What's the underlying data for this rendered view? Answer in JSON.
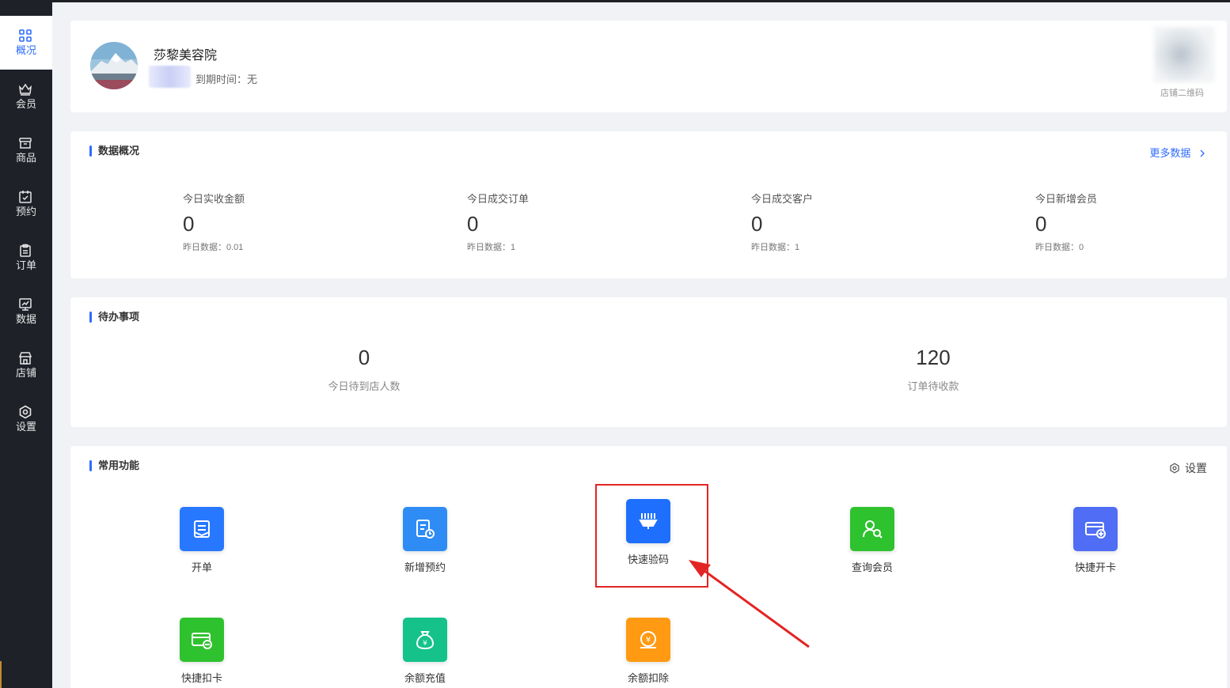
{
  "sidebar": {
    "items": [
      {
        "label": "概况",
        "icon": "grid-icon",
        "active": true
      },
      {
        "label": "会员",
        "icon": "crown-icon"
      },
      {
        "label": "商品",
        "icon": "store-box-icon"
      },
      {
        "label": "预约",
        "icon": "calendar-check-icon"
      },
      {
        "label": "订单",
        "icon": "clipboard-icon"
      },
      {
        "label": "数据",
        "icon": "monitor-chart-icon"
      },
      {
        "label": "店铺",
        "icon": "shop-icon"
      },
      {
        "label": "设置",
        "icon": "gear-icon"
      }
    ]
  },
  "shop": {
    "name": "莎黎美容院",
    "expire": "到期时间：无",
    "qr_label": "店铺二维码"
  },
  "overview": {
    "title": "数据概况",
    "more": "更多数据",
    "stats": [
      {
        "title": "今日实收金额",
        "value": "0",
        "yesterday": "昨日数据：0.01"
      },
      {
        "title": "今日成交订单",
        "value": "0",
        "yesterday": "昨日数据：1"
      },
      {
        "title": "今日成交客户",
        "value": "0",
        "yesterday": "昨日数据：1"
      },
      {
        "title": "今日新增会员",
        "value": "0",
        "yesterday": "昨日数据：0"
      }
    ]
  },
  "todo": {
    "title": "待办事项",
    "items": [
      {
        "value": "0",
        "label": "今日待到店人数"
      },
      {
        "value": "120",
        "label": "订单待收款"
      }
    ]
  },
  "functions": {
    "title": "常用功能",
    "settings": "设置",
    "items": [
      {
        "label": "开单",
        "icon": "open-order-icon",
        "color": "#2878ff"
      },
      {
        "label": "新增预约",
        "icon": "new-appointment-icon",
        "color": "#2f8cf5"
      },
      {
        "label": "快速验码",
        "icon": "scan-code-icon",
        "color": "#1f6fff"
      },
      {
        "label": "查询会员",
        "icon": "search-member-icon",
        "color": "#2fc22f"
      },
      {
        "label": "快捷开卡",
        "icon": "open-card-icon",
        "color": "#4f6df5"
      },
      {
        "label": "快捷扣卡",
        "icon": "deduct-card-icon",
        "color": "#2fc22f"
      },
      {
        "label": "余额充值",
        "icon": "money-bag-icon",
        "color": "#14c28a"
      },
      {
        "label": "余额扣除",
        "icon": "coin-deduct-icon",
        "color": "#ff9a12"
      }
    ]
  }
}
